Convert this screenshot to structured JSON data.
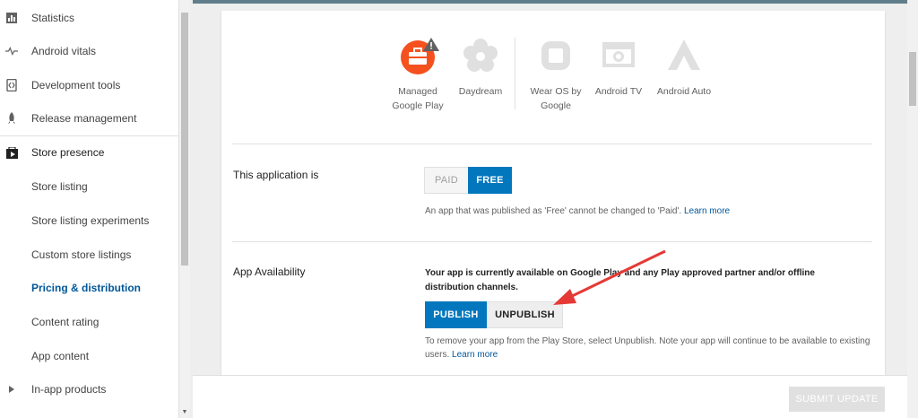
{
  "sidebar": {
    "items": [
      {
        "label": "Statistics",
        "icon": "bar-chart-icon"
      },
      {
        "label": "Android vitals",
        "icon": "pulse-icon"
      },
      {
        "label": "Development tools",
        "icon": "code-icon"
      },
      {
        "label": "Release management",
        "icon": "rocket-icon"
      },
      {
        "label": "Store presence",
        "icon": "play-store-icon"
      },
      {
        "label": "Store listing"
      },
      {
        "label": "Store listing experiments"
      },
      {
        "label": "Custom store listings"
      },
      {
        "label": "Pricing & distribution"
      },
      {
        "label": "Content rating"
      },
      {
        "label": "App content"
      },
      {
        "label": "In-app products",
        "icon": "triangle-right-icon"
      }
    ],
    "active_label": "Pricing & distribution"
  },
  "devices": [
    {
      "label_1": "Managed",
      "label_2": "Google Play",
      "icon": "briefcase-icon",
      "color": "#f4511e"
    },
    {
      "label_1": "Daydream",
      "label_2": "",
      "icon": "daydream-icon"
    },
    {
      "label_1": "Wear OS by",
      "label_2": "Google",
      "icon": "watch-icon"
    },
    {
      "label_1": "Android TV",
      "label_2": "",
      "icon": "tv-icon"
    },
    {
      "label_1": "Android Auto",
      "label_2": "",
      "icon": "auto-icon"
    }
  ],
  "pricing": {
    "label": "This application is",
    "paid_label": "PAID",
    "free_label": "FREE",
    "help_text": "An app that was published as 'Free' cannot be changed to 'Paid'.",
    "learn_more": "Learn more"
  },
  "availability": {
    "label": "App Availability",
    "status_text": "Your app is currently available on Google Play and any Play approved partner and/or offline distribution channels.",
    "publish_label": "PUBLISH",
    "unpublish_label": "UNPUBLISH",
    "help_text": "To remove your app from the Play Store, select Unpublish. Note your app will continue to be available to existing users.",
    "learn_more": "Learn more"
  },
  "footer": {
    "submit_label": "SUBMIT UPDATE"
  },
  "colors": {
    "accent": "#0277bd",
    "annotation_arrow": "#e53935"
  }
}
